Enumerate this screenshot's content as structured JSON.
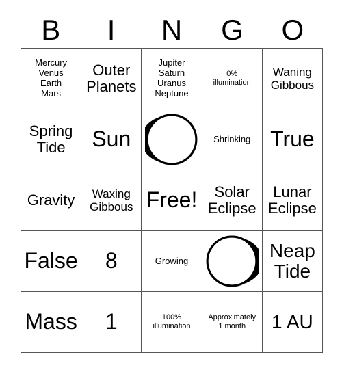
{
  "card": {
    "title_letters": [
      "B",
      "I",
      "N",
      "G",
      "O"
    ],
    "free_space_label": "Free!",
    "rows": [
      [
        {
          "name": "inner-planets",
          "text": "Mercury\nVenus\nEarth\nMars",
          "size": "fs-s",
          "kind": "text"
        },
        {
          "name": "outer-planets",
          "text": "Outer\nPlanets",
          "size": "fs-l",
          "kind": "text"
        },
        {
          "name": "outer-planet-names",
          "text": "Jupiter\nSaturn\nUranus\nNeptune",
          "size": "fs-s",
          "kind": "text"
        },
        {
          "name": "zero-percent-illumination",
          "text": "0%\nillumination",
          "size": "fs-xs",
          "kind": "text"
        },
        {
          "name": "waning-gibbous",
          "text": "Waning\nGibbous",
          "size": "fs-m",
          "kind": "text"
        }
      ],
      [
        {
          "name": "spring-tide",
          "text": "Spring\nTide",
          "size": "fs-l",
          "kind": "text"
        },
        {
          "name": "sun",
          "text": "Sun",
          "size": "fs-xxl",
          "kind": "text"
        },
        {
          "name": "waning-crescent-moon-image",
          "text": "",
          "size": "fs-m",
          "kind": "moon",
          "moon": "waning-crescent"
        },
        {
          "name": "shrinking",
          "text": "Shrinking",
          "size": "fs-s",
          "kind": "text"
        },
        {
          "name": "true",
          "text": "True",
          "size": "fs-xxl",
          "kind": "text"
        }
      ],
      [
        {
          "name": "gravity",
          "text": "Gravity",
          "size": "fs-l",
          "kind": "text"
        },
        {
          "name": "waxing-gibbous",
          "text": "Waxing\nGibbous",
          "size": "fs-m",
          "kind": "text"
        },
        {
          "name": "free-space",
          "text": "Free!",
          "size": "fs-xxl",
          "kind": "text"
        },
        {
          "name": "solar-eclipse",
          "text": "Solar\nEclipse",
          "size": "fs-l",
          "kind": "text"
        },
        {
          "name": "lunar-eclipse",
          "text": "Lunar\nEclipse",
          "size": "fs-l",
          "kind": "text"
        }
      ],
      [
        {
          "name": "false",
          "text": "False",
          "size": "fs-xxl",
          "kind": "text"
        },
        {
          "name": "eight",
          "text": "8",
          "size": "fs-xxl",
          "kind": "text"
        },
        {
          "name": "growing",
          "text": "Growing",
          "size": "fs-s",
          "kind": "text"
        },
        {
          "name": "waxing-crescent-moon-image",
          "text": "",
          "size": "fs-m",
          "kind": "moon",
          "moon": "waxing-crescent"
        },
        {
          "name": "neap-tide",
          "text": "Neap\nTide",
          "size": "fs-xl",
          "kind": "text"
        }
      ],
      [
        {
          "name": "mass",
          "text": "Mass",
          "size": "fs-xxl",
          "kind": "text"
        },
        {
          "name": "one",
          "text": "1",
          "size": "fs-xxl",
          "kind": "text"
        },
        {
          "name": "full-illumination",
          "text": "100%\nillumination",
          "size": "fs-xs",
          "kind": "text"
        },
        {
          "name": "approximately-one-month",
          "text": "Approximately\n1 month",
          "size": "fs-xs",
          "kind": "text"
        },
        {
          "name": "one-au",
          "text": "1 AU",
          "size": "fs-xl",
          "kind": "text"
        }
      ]
    ]
  },
  "colors": {
    "ink": "#000000",
    "grid_line": "#555555",
    "background": "#ffffff",
    "moon_dark": "#000000",
    "moon_light": "#ffffff"
  }
}
